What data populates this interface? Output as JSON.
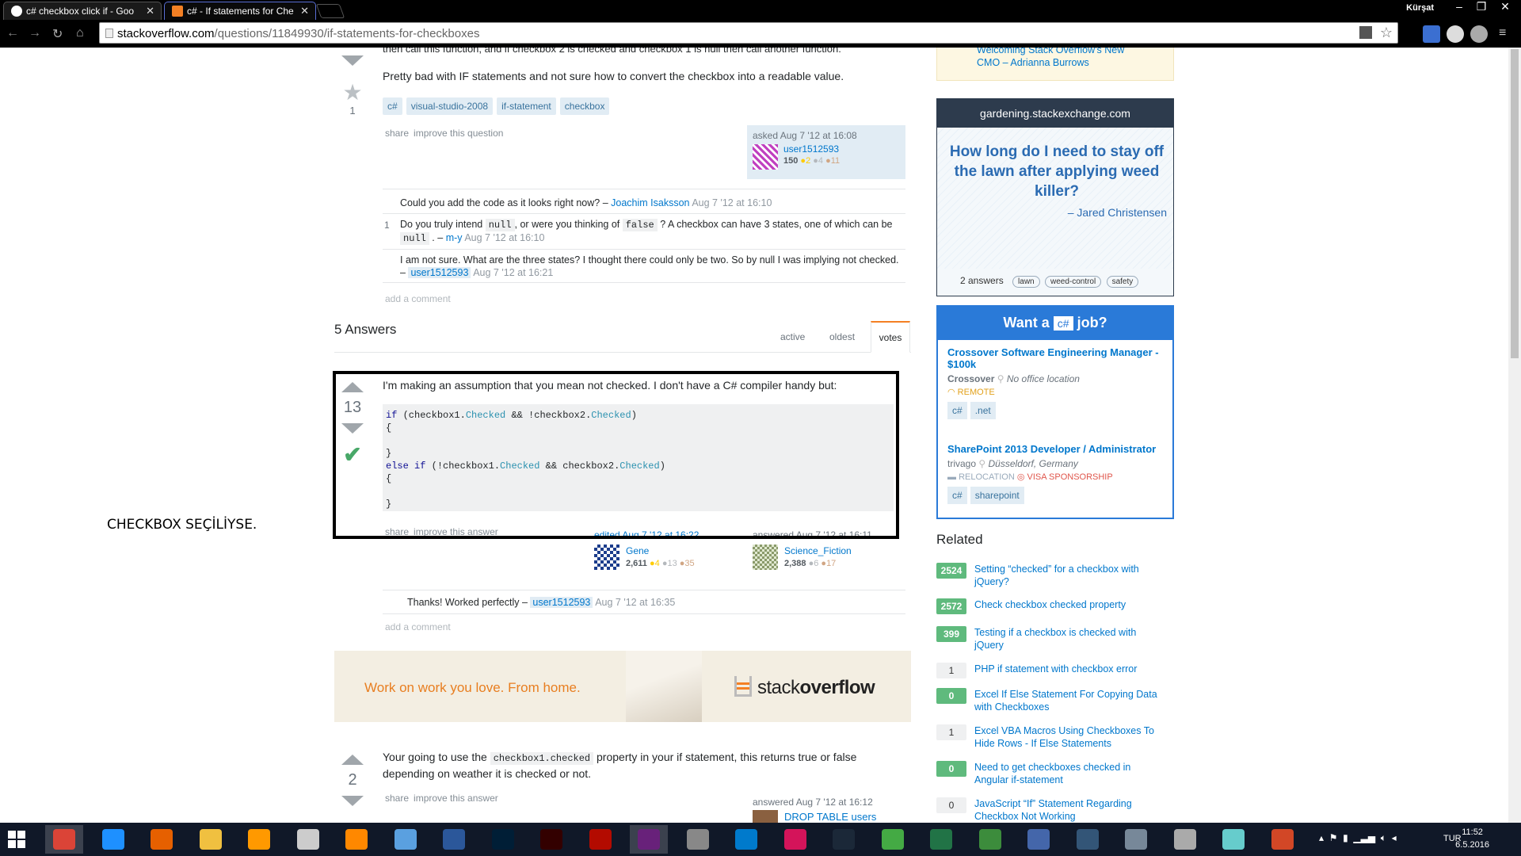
{
  "browser": {
    "tabs": [
      {
        "title": "c# checkbox click if - Goo"
      },
      {
        "title": "c# - If statements for Che"
      }
    ],
    "user": "Kürşat",
    "url_domain": "stackoverflow.com",
    "url_path": "/questions/11849930/if-statements-for-checkboxes"
  },
  "question": {
    "partial_line": "then call this function, and if checkbox 2 is checked and checkbox 1 is null then call another function.",
    "body": "Pretty bad with IF statements and not sure how to convert the checkbox into a readable value.",
    "favorites": "1",
    "tags": [
      "c#",
      "visual-studio-2008",
      "if-statement",
      "checkbox"
    ],
    "menu": [
      "share",
      "improve this question"
    ],
    "asked": "asked Aug 7 '12 at 16:08",
    "user": "user1512593",
    "rep": "150",
    "gold": "●2",
    "silver": "●4",
    "bronze": "●11",
    "comments": [
      {
        "count": "",
        "text": "Could you add the code as it looks right now? –",
        "user": "Joachim Isaksson",
        "date": "Aug 7 '12 at 16:10"
      },
      {
        "count": "1",
        "text_a": "Do you truly intend",
        "code_a": "null",
        "text_b": ", or were you thinking of",
        "code_b": "false",
        "text_c": "? A checkbox can have 3 states, one of which can be",
        "code_c": "null",
        "text_d": ". –",
        "user": "m-y",
        "date": "Aug 7 '12 at 16:10"
      },
      {
        "count": "",
        "text": "I am not sure. What are the three states? I thought there could only be two. So by null I was implying not checked. –",
        "user": "user1512593",
        "date": "Aug 7 '12 at 16:21"
      }
    ],
    "add_comment": "add a comment"
  },
  "answers_header": {
    "title": "5 Answers",
    "tabs": [
      "active",
      "oldest",
      "votes"
    ]
  },
  "annotation": "CHECKBOX SEÇİLİYSE.",
  "answer1": {
    "votes": "13",
    "body": "I'm making an assumption that you mean not checked. I don't have a C# compiler handy but:",
    "code": [
      [
        {
          "t": "if",
          "k": "kw"
        },
        {
          "t": " (checkbox1.",
          "k": ""
        },
        {
          "t": "Checked",
          "k": "pr"
        },
        {
          "t": " && !checkbox2.",
          "k": ""
        },
        {
          "t": "Checked",
          "k": "pr"
        },
        {
          "t": ")",
          "k": ""
        }
      ],
      [
        {
          "t": "{",
          "k": ""
        }
      ],
      [
        {
          "t": "",
          "k": ""
        }
      ],
      [
        {
          "t": "}",
          "k": ""
        }
      ],
      [
        {
          "t": "else if",
          "k": "kw"
        },
        {
          "t": " (!checkbox1.",
          "k": ""
        },
        {
          "t": "Checked",
          "k": "pr"
        },
        {
          "t": " && checkbox2.",
          "k": ""
        },
        {
          "t": "Checked",
          "k": "pr"
        },
        {
          "t": ")",
          "k": ""
        }
      ],
      [
        {
          "t": "{",
          "k": ""
        }
      ],
      [
        {
          "t": "",
          "k": ""
        }
      ],
      [
        {
          "t": "}",
          "k": ""
        }
      ]
    ],
    "menu": [
      "share",
      "improve this answer"
    ],
    "edited": "edited Aug 7 '12 at 16:22",
    "answered": "answered Aug 7 '12 at 16:11",
    "editor": {
      "name": "Gene",
      "rep": "2,611",
      "gold": "●4",
      "silver": "●13",
      "bronze": "●35"
    },
    "author": {
      "name": "Science_Fiction",
      "rep": "2,388",
      "silver": "●6",
      "bronze": "●17"
    },
    "comment": {
      "text": "Thanks! Worked perfectly –",
      "user": "user1512593",
      "date": "Aug 7 '12 at 16:35"
    },
    "add_comment": "add a comment"
  },
  "ad": {
    "text": "Work on work you love. From home.",
    "brand_a": "stack",
    "brand_b": "overflow"
  },
  "answer2": {
    "votes": "2",
    "text_a": "Your going to use the",
    "code": "checkbox1.checked",
    "text_b": "property in your if statement, this returns true or false depending on weather it is checked or not.",
    "menu": [
      "share",
      "improve this answer"
    ],
    "answered": "answered Aug 7 '12 at 16:12",
    "author": "DROP TABLE users"
  },
  "sidebar": {
    "blog_line1": "Welcoming Stack Overflow's New",
    "blog_line2": "CMO – Adrianna Burrows",
    "gardening": {
      "site": "gardening.stackexchange.com",
      "question": "How long do I need to stay off the lawn after applying weed killer?",
      "author": "– Jared Christensen",
      "answers": "2 answers",
      "tags": [
        "lawn",
        "weed-control",
        "safety"
      ]
    },
    "jobs": {
      "head_a": "Want a",
      "head_tag": "c#",
      "head_b": "job?",
      "items": [
        {
          "title": "Crossover Software Engineering Manager - $100k",
          "company": "Crossover",
          "location": "No office location",
          "perk1": "REMOTE",
          "perk2": "",
          "tags": [
            "c#",
            ".net"
          ]
        },
        {
          "title": "SharePoint 2013 Developer / Administrator",
          "company": "trivago",
          "location": "Düsseldorf, Germany",
          "perk1": "RELOCATION",
          "perk2": "VISA SPONSORSHIP",
          "tags": [
            "c#",
            "sharepoint"
          ]
        }
      ]
    },
    "related_title": "Related",
    "related": [
      {
        "count": "2524",
        "accepted": true,
        "title": "Setting “checked” for a checkbox with jQuery?"
      },
      {
        "count": "2572",
        "accepted": true,
        "title": "Check checkbox checked property"
      },
      {
        "count": "399",
        "accepted": true,
        "title": "Testing if a checkbox is checked with jQuery"
      },
      {
        "count": "1",
        "accepted": false,
        "title": "PHP if statement with checkbox error"
      },
      {
        "count": "0",
        "accepted": true,
        "title": "Excel If Else Statement For Copying Data with Checkboxes"
      },
      {
        "count": "1",
        "accepted": false,
        "title": "Excel VBA Macros Using Checkboxes To Hide Rows - If Else Statements"
      },
      {
        "count": "0",
        "accepted": true,
        "title": "Need to get checkboxes checked in Angular if-statement"
      },
      {
        "count": "0",
        "accepted": false,
        "title": "JavaScript “If” Statement Regarding Checkbox Not Working"
      }
    ]
  },
  "taskbar": {
    "apps": [
      {
        "name": "chrome-icon",
        "color": "#db4437"
      },
      {
        "name": "ie-icon",
        "color": "#1e90ff"
      },
      {
        "name": "firefox-icon",
        "color": "#e66000"
      },
      {
        "name": "explorer-icon",
        "color": "#f0c040"
      },
      {
        "name": "orange-app-icon",
        "color": "#ff9900"
      },
      {
        "name": "snipping-tool-icon",
        "color": "#cccccc"
      },
      {
        "name": "vlc-icon",
        "color": "#ff8800"
      },
      {
        "name": "paint-icon",
        "color": "#5aa0e0"
      },
      {
        "name": "word-icon",
        "color": "#2b579a"
      },
      {
        "name": "photoshop-icon",
        "color": "#001e36"
      },
      {
        "name": "illustrator-icon",
        "color": "#330000"
      },
      {
        "name": "acrobat-icon",
        "color": "#b30b00"
      },
      {
        "name": "visual-studio-icon",
        "color": "#68217a"
      },
      {
        "name": "tools-icon",
        "color": "#888888"
      },
      {
        "name": "vscode-icon",
        "color": "#007acc"
      },
      {
        "name": "acrobat-dc-icon",
        "color": "#d4145a"
      },
      {
        "name": "steam-icon",
        "color": "#1b2838"
      },
      {
        "name": "globe-icon",
        "color": "#44aa44"
      },
      {
        "name": "excel-icon",
        "color": "#217346"
      },
      {
        "name": "notepad-icon",
        "color": "#3c8c3c"
      },
      {
        "name": "dev-icon",
        "color": "#4466aa"
      },
      {
        "name": "media-icon",
        "color": "#335577"
      },
      {
        "name": "calculator-icon",
        "color": "#778899"
      },
      {
        "name": "disc-icon",
        "color": "#aaaaaa"
      },
      {
        "name": "edit-icon",
        "color": "#66cccc"
      },
      {
        "name": "powerpoint-icon",
        "color": "#d24726"
      }
    ],
    "lang": "TUR",
    "time": "11:52",
    "date": "6.5.2016"
  }
}
